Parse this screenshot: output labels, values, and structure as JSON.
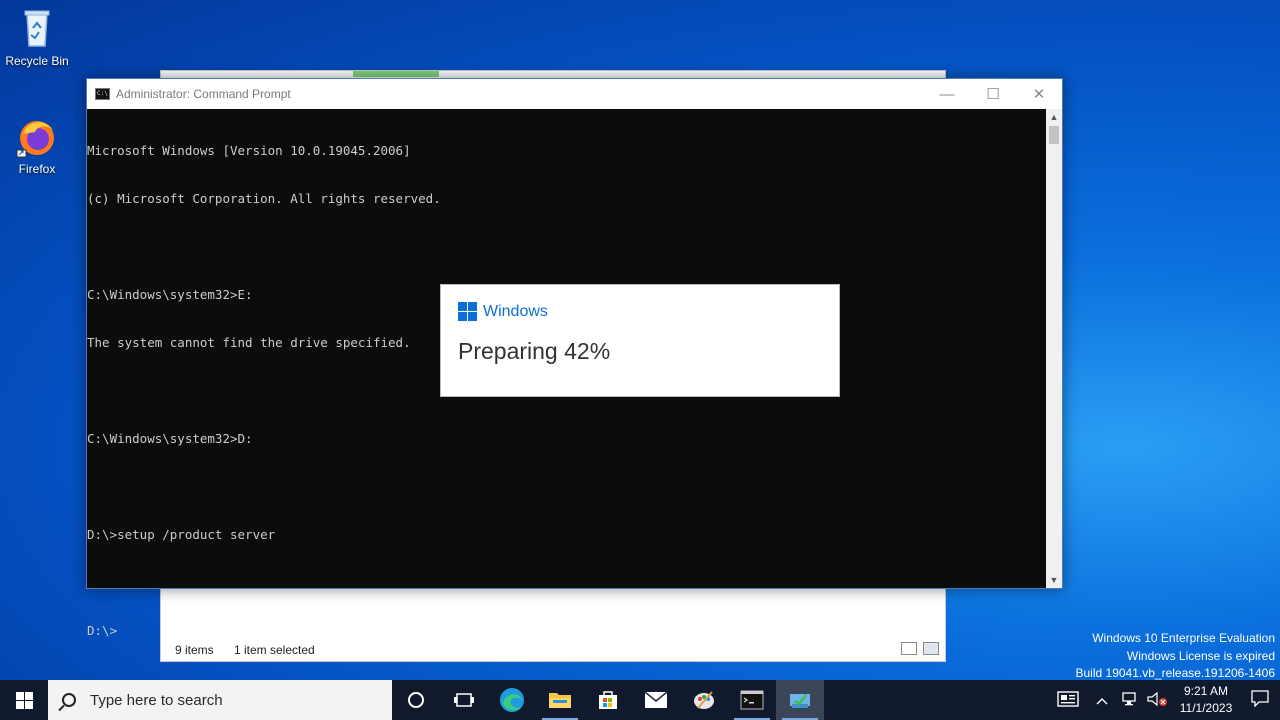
{
  "desktop": {
    "icons": [
      {
        "label": "Recycle Bin",
        "icon": "recycle-bin-icon"
      },
      {
        "label": "Firefox",
        "icon": "firefox-icon"
      }
    ]
  },
  "explorer": {
    "status_items": "9 items",
    "status_selected": "1 item selected"
  },
  "cmd": {
    "title": "Administrator: Command Prompt",
    "lines": [
      "Microsoft Windows [Version 10.0.19045.2006]",
      "(c) Microsoft Corporation. All rights reserved.",
      "",
      "C:\\Windows\\system32>E:",
      "The system cannot find the drive specified.",
      "",
      "C:\\Windows\\system32>D:",
      "",
      "D:\\>setup /product server",
      "",
      "D:\\>"
    ]
  },
  "setup": {
    "brand": "Windows",
    "status": "Preparing 42%",
    "progress_percent": 42
  },
  "watermark": {
    "line1": "Windows 10 Enterprise Evaluation",
    "line2": "Windows License is expired",
    "line3": "Build 19041.vb_release.191206-1406"
  },
  "taskbar": {
    "search_placeholder": "Type here to search",
    "time": "9:21 AM",
    "date": "11/1/2023",
    "accent": "#0a6fd6"
  }
}
